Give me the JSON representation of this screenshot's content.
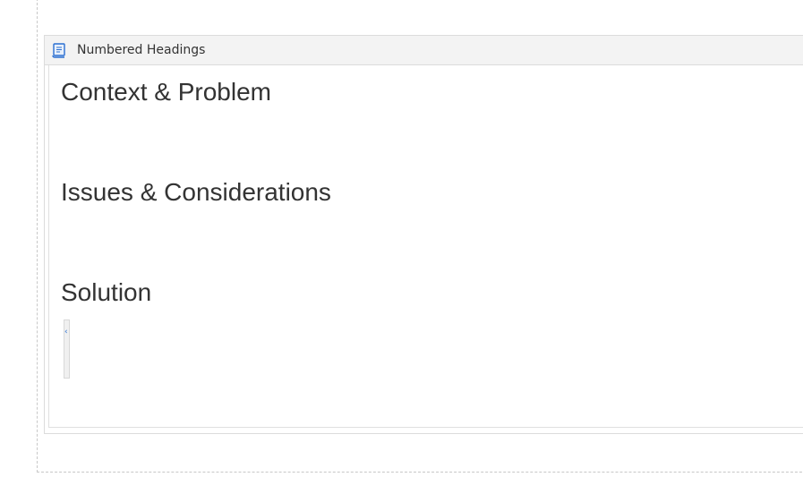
{
  "macro": {
    "title": "Numbered Headings",
    "icon": "scroll-icon"
  },
  "headings": [
    "Context & Problem",
    "Issues & Considerations",
    "Solution"
  ],
  "collapse_handle": {
    "icon": "chevron-left-icon",
    "glyph": "‹"
  },
  "colors": {
    "header_background": "#f3f3f3",
    "heading_text": "#333333",
    "accent": "#2b6fd1"
  }
}
